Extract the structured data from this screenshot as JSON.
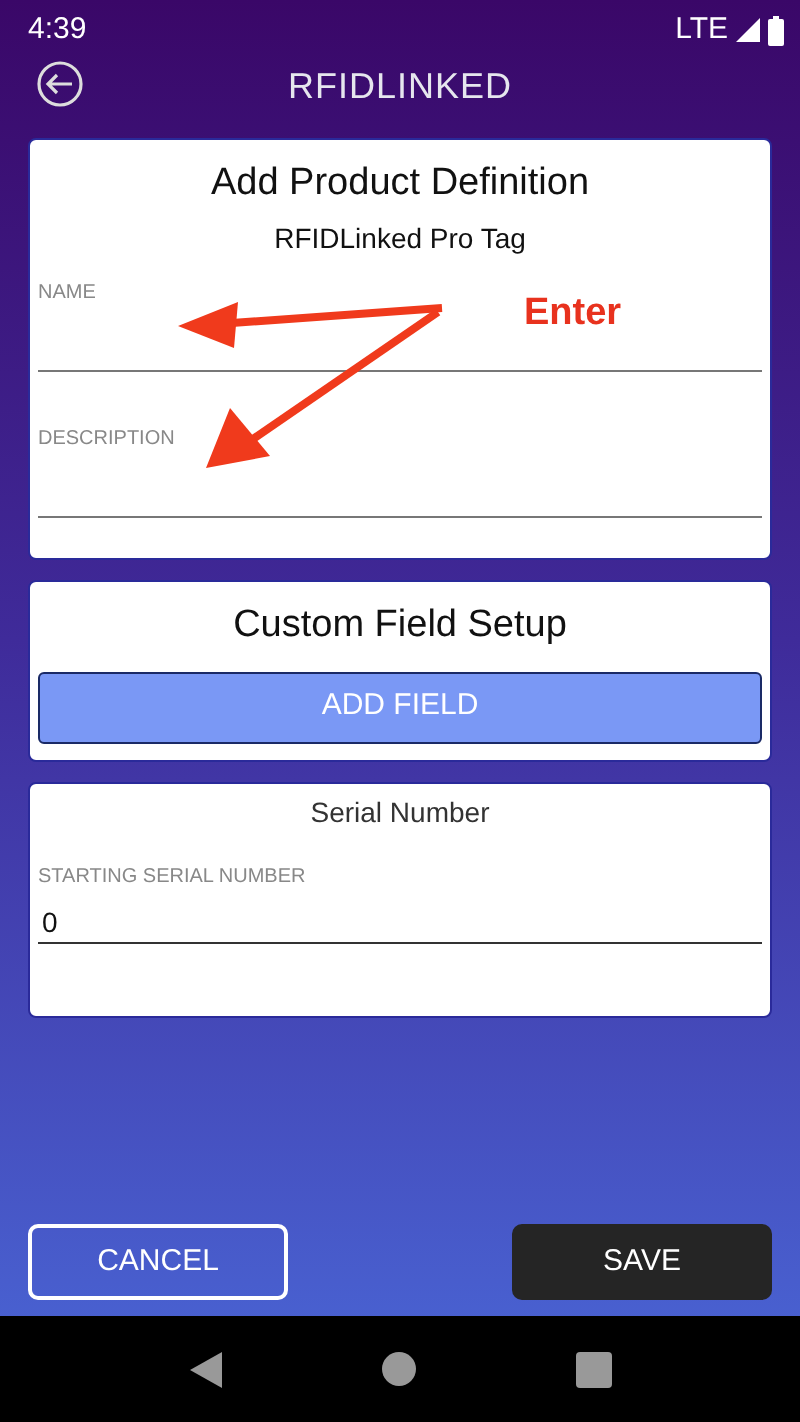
{
  "status_bar": {
    "time": "4:39",
    "network": "LTE"
  },
  "header": {
    "logo": "**RFID**LINKED"
  },
  "product_card": {
    "title": "Add Product Definition",
    "subtitle": "RFIDLinked Pro Tag",
    "fields": [
      {
        "label": "NAME"
      },
      {
        "label": "DESCRIPTION"
      }
    ]
  },
  "annotation": {
    "text": "Enter"
  },
  "custom_field_card": {
    "title": "Custom Field Setup",
    "button": "ADD FIELD"
  },
  "serial_card": {
    "title": "Serial Number",
    "field": {
      "label": "STARTING SERIAL NUMBER",
      "value": "0"
    }
  },
  "buttons": [
    {
      "label": "CANCEL",
      "kind": "outline"
    },
    {
      "label": "SAVE",
      "kind": "dark"
    }
  ]
}
